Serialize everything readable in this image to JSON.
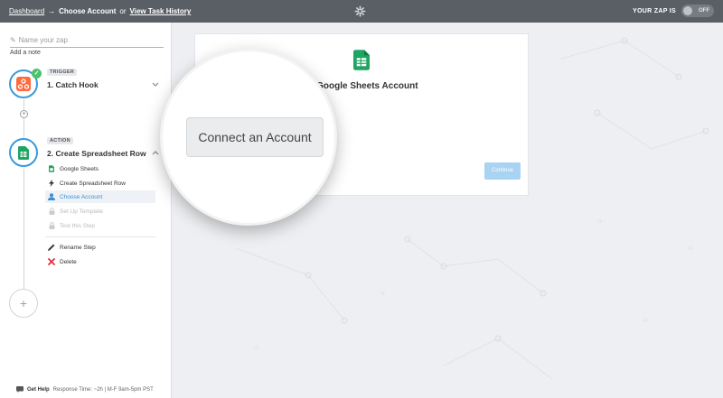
{
  "topbar": {
    "dashboard": "Dashboard",
    "arrow": "→",
    "current": "Choose Account",
    "or": "or",
    "history": "View Task History",
    "zap_label": "YOUR ZAP IS",
    "toggle_state": "OFF"
  },
  "sidebar": {
    "zap_name_placeholder": "Name your zap",
    "add_note": "Add a note",
    "trigger": {
      "badge": "TRIGGER",
      "title": "1. Catch Hook"
    },
    "action": {
      "badge": "ACTION",
      "title": "2. Create Spreadsheet Row",
      "items": [
        {
          "label": "Google Sheets"
        },
        {
          "label": "Create Spreadsheet Row"
        },
        {
          "label": "Choose Account"
        },
        {
          "label": "Set Up Template"
        },
        {
          "label": "Test this Step"
        },
        {
          "label": "Rename Step"
        },
        {
          "label": "Delete"
        }
      ]
    },
    "add_symbol": "+",
    "help": {
      "label": "Get Help",
      "response": "Response Time: ~2h | M-F 9am-5pm PST"
    }
  },
  "main": {
    "title_partial": "t Google Sheets Account",
    "connect_label": "Connect an Account",
    "continue_label": "Continue"
  },
  "colors": {
    "topbar": "#5a5f66",
    "accent": "#3a9ad9",
    "success": "#4dc26a",
    "sheets_green": "#1fa463",
    "delete_red": "#e0323c"
  }
}
